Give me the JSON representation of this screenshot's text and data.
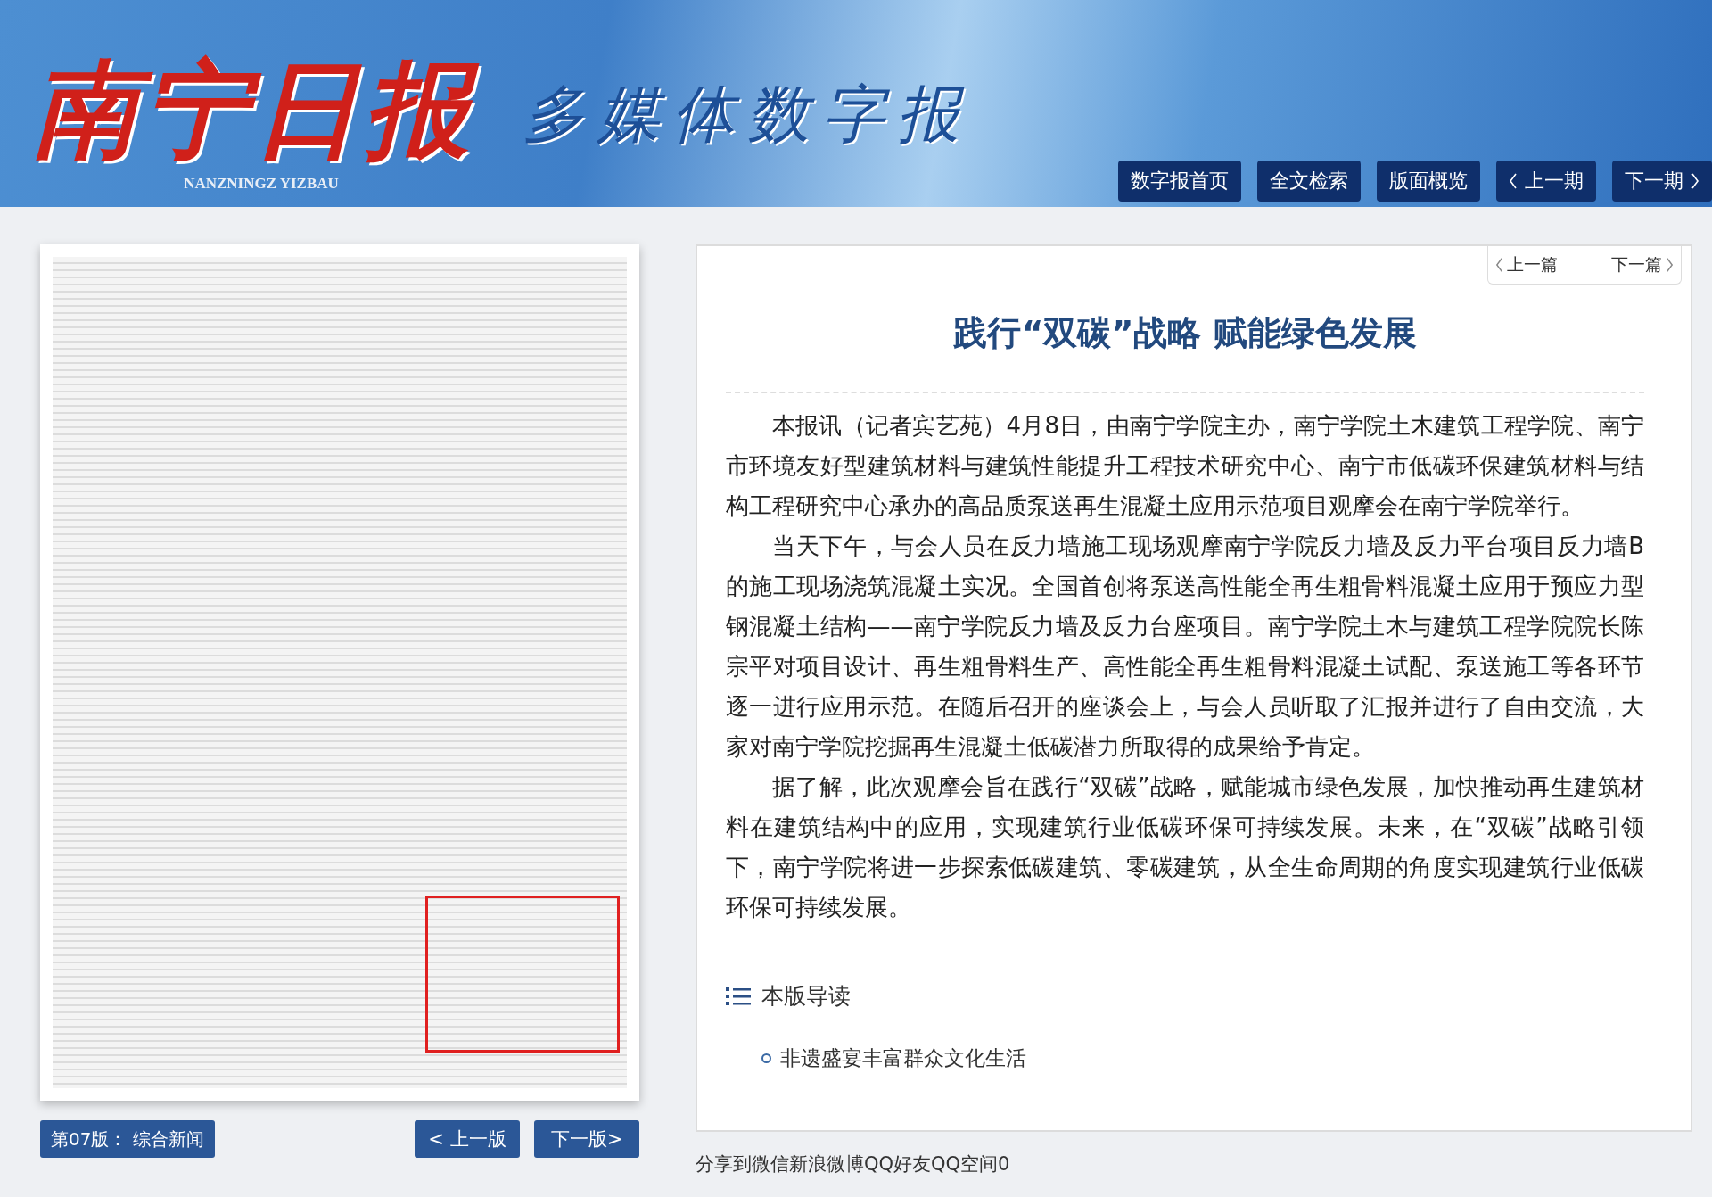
{
  "header": {
    "logo_title": "南宁日报",
    "logo_subtitle": "多媒体数字报",
    "logo_pinyin": "NANZNINGZ YIZBAU",
    "nav": [
      {
        "label": "数字报首页",
        "kind": "plain"
      },
      {
        "label": "全文检索",
        "kind": "plain"
      },
      {
        "label": "版面概览",
        "kind": "plain"
      },
      {
        "label": "上一期",
        "kind": "prev"
      },
      {
        "label": "下一期",
        "kind": "next"
      }
    ]
  },
  "page_view": {
    "page_label": "第07版： 综合新闻",
    "prev_page": "< 上一版",
    "next_page": "下一版>"
  },
  "article": {
    "prev": "上一篇",
    "next": "下一篇",
    "title": "践行“双碳”战略 赋能绿色发展",
    "paragraphs": [
      "本报讯（记者宾艺苑）4月8日，由南宁学院主办，南宁学院土木建筑工程学院、南宁市环境友好型建筑材料与建筑性能提升工程技术研究中心、南宁市低碳环保建筑材料与结构工程研究中心承办的高品质泵送再生混凝土应用示范项目观摩会在南宁学院举行。",
      "当天下午，与会人员在反力墙施工现场观摩南宁学院反力墙及反力平台项目反力墙B的施工现场浇筑混凝土实况。全国首创将泵送高性能全再生粗骨料混凝土应用于预应力型钢混凝土结构——南宁学院反力墙及反力台座项目。南宁学院土木与建筑工程学院院长陈宗平对项目设计、再生粗骨料生产、高性能全再生粗骨料混凝土试配、泵送施工等各环节逐一进行应用示范。在随后召开的座谈会上，与会人员听取了汇报并进行了自由交流，大家对南宁学院挖掘再生混凝土低碳潜力所取得的成果给予肯定。",
      "据了解，此次观摩会旨在践行“双碳”战略，赋能城市绿色发展，加快推动再生建筑材料在建筑结构中的应用，实现建筑行业低碳环保可持续发展。未来，在“双碳”战略引领下，南宁学院将进一步探索低碳建筑、零碳建筑，从全生命周期的角度实现建筑行业低碳环保可持续发展。"
    ],
    "guide_title": "本版导读",
    "guide_items": [
      "非遗盛宴丰富群众文化生活"
    ]
  },
  "share": "分享到微信新浪微博QQ好友QQ空间0"
}
